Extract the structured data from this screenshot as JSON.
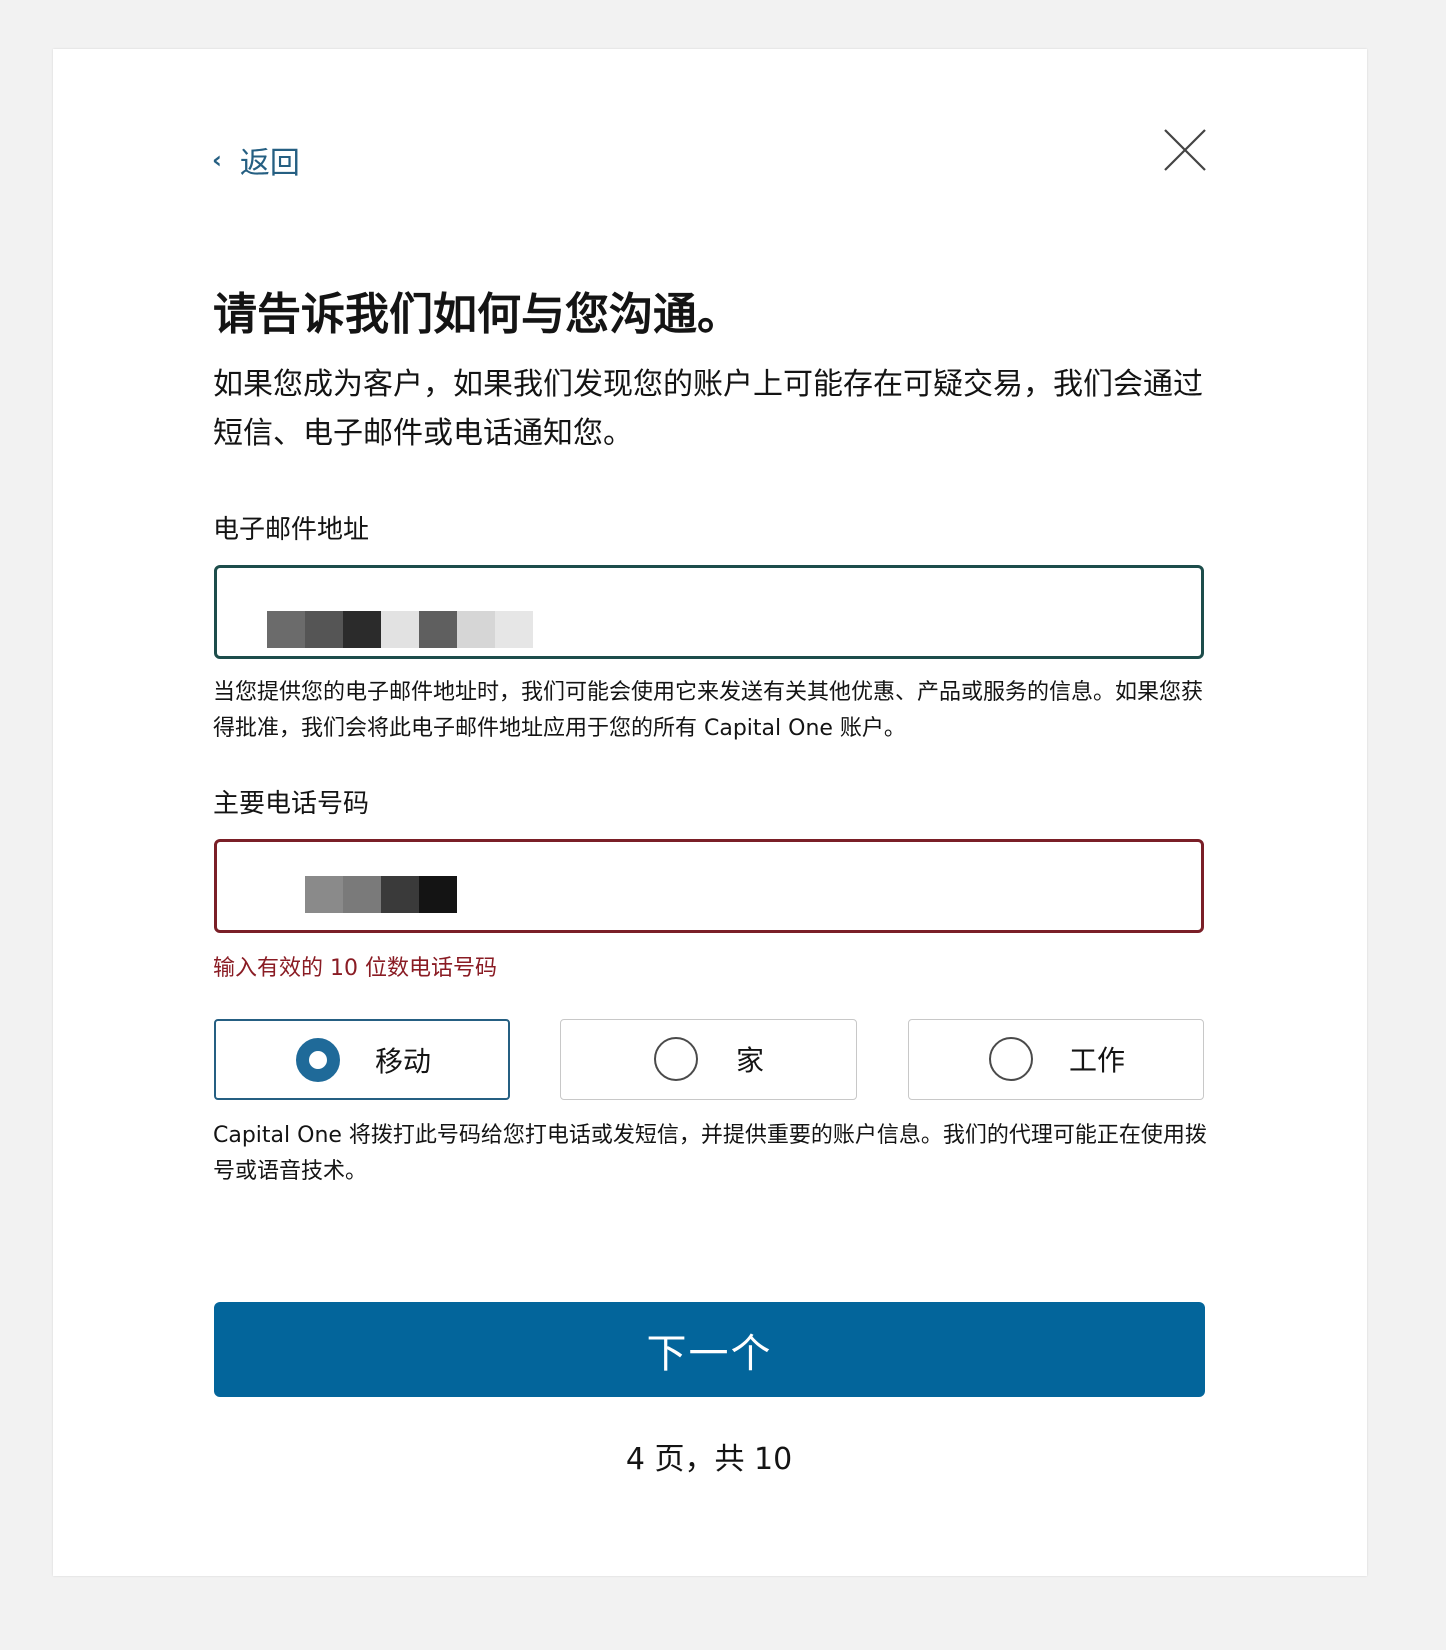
{
  "nav": {
    "back_label": "返回"
  },
  "header": {
    "title": "请告诉我们如何与您沟通。",
    "intro": "如果您成为客户，如果我们发现您的账户上可能存在可疑交易，我们会通过短信、电子邮件或电话通知您。"
  },
  "email": {
    "label": "电子邮件地址",
    "value": "",
    "helper": "当您提供您的电子邮件地址时，我们可能会使用它来发送有关其他优惠、产品或服务的信息。如果您获得批准，我们会将此电子邮件地址应用于您的所有 Capital One 账户。"
  },
  "phone": {
    "label": "主要电话号码",
    "value": "",
    "error": "输入有效的 10 位数电话号码",
    "types": [
      {
        "label": "移动",
        "selected": true
      },
      {
        "label": "家",
        "selected": false
      },
      {
        "label": "工作",
        "selected": false
      }
    ],
    "helper": "Capital One 将拨打此号码给您打电话或发短信，并提供重要的账户信息。我们的代理可能正在使用拨号或语音技术。"
  },
  "actions": {
    "next_label": "下一个"
  },
  "progress": {
    "label": "4 页，共 10",
    "current_page": 4,
    "total_pages": 10
  },
  "colors": {
    "primary": "#03659b",
    "link": "#255f82",
    "error": "#8a1c24",
    "email_border": "#1d4d4b"
  },
  "icons": {
    "back": "chevron-left-icon",
    "close": "close-icon"
  }
}
